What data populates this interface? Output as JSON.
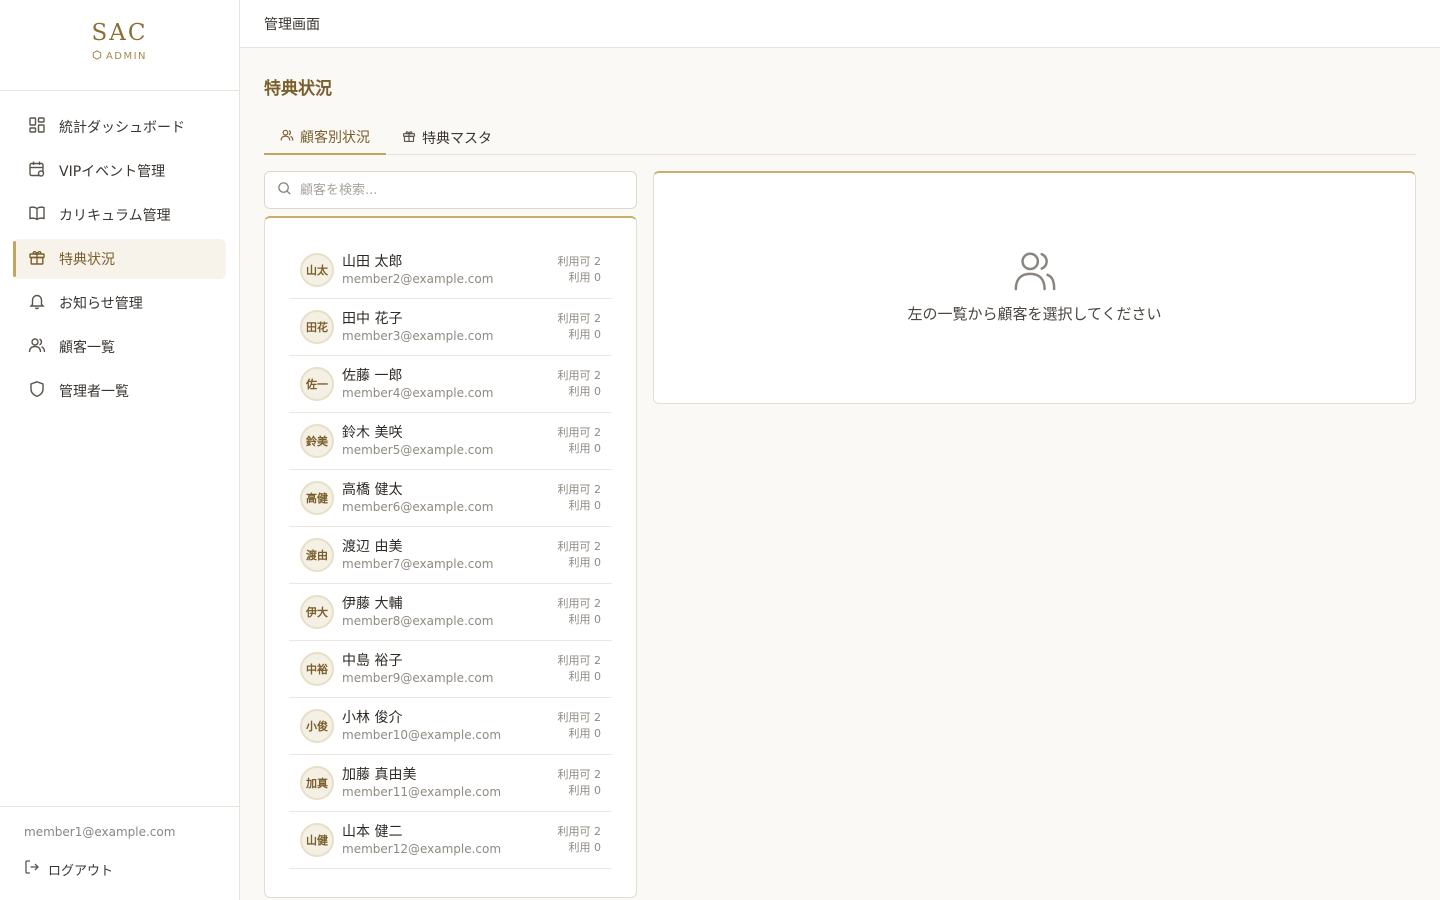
{
  "brand": {
    "name": "SAC",
    "sub": "ADMIN"
  },
  "nav": {
    "items": [
      {
        "label": "統計ダッシュボード",
        "icon": "dashboard-icon"
      },
      {
        "label": "VIPイベント管理",
        "icon": "calendar-icon"
      },
      {
        "label": "カリキュラム管理",
        "icon": "book-icon"
      },
      {
        "label": "特典状況",
        "icon": "gift-icon",
        "active": true
      },
      {
        "label": "お知らせ管理",
        "icon": "bell-icon"
      },
      {
        "label": "顧客一覧",
        "icon": "users-icon"
      },
      {
        "label": "管理者一覧",
        "icon": "shield-icon"
      }
    ]
  },
  "footer": {
    "email": "member1@example.com",
    "logout_label": "ログアウト"
  },
  "header": {
    "title": "管理画面"
  },
  "page": {
    "title": "特典状況"
  },
  "tabs": [
    {
      "label": "顧客別状況",
      "icon": "users-icon",
      "active": true
    },
    {
      "label": "特典マスタ",
      "icon": "gift-icon"
    }
  ],
  "search": {
    "placeholder": "顧客を検索...",
    "value": ""
  },
  "customers": [
    {
      "initials": "山太",
      "name": "山田 太郎",
      "email": "member2@example.com",
      "available": "利用可 2",
      "used": "利用 0"
    },
    {
      "initials": "田花",
      "name": "田中 花子",
      "email": "member3@example.com",
      "available": "利用可 2",
      "used": "利用 0"
    },
    {
      "initials": "佐一",
      "name": "佐藤 一郎",
      "email": "member4@example.com",
      "available": "利用可 2",
      "used": "利用 0"
    },
    {
      "initials": "鈴美",
      "name": "鈴木 美咲",
      "email": "member5@example.com",
      "available": "利用可 2",
      "used": "利用 0"
    },
    {
      "initials": "高健",
      "name": "高橋 健太",
      "email": "member6@example.com",
      "available": "利用可 2",
      "used": "利用 0"
    },
    {
      "initials": "渡由",
      "name": "渡辺 由美",
      "email": "member7@example.com",
      "available": "利用可 2",
      "used": "利用 0"
    },
    {
      "initials": "伊大",
      "name": "伊藤 大輔",
      "email": "member8@example.com",
      "available": "利用可 2",
      "used": "利用 0"
    },
    {
      "initials": "中裕",
      "name": "中島 裕子",
      "email": "member9@example.com",
      "available": "利用可 2",
      "used": "利用 0"
    },
    {
      "initials": "小俊",
      "name": "小林 俊介",
      "email": "member10@example.com",
      "available": "利用可 2",
      "used": "利用 0"
    },
    {
      "initials": "加真",
      "name": "加藤 真由美",
      "email": "member11@example.com",
      "available": "利用可 2",
      "used": "利用 0"
    },
    {
      "initials": "山健",
      "name": "山本 健二",
      "email": "member12@example.com",
      "available": "利用可 2",
      "used": "利用 0"
    }
  ],
  "detail": {
    "empty_message": "左の一覧から顧客を選択してください",
    "icon": "users-icon"
  },
  "colors": {
    "accent": "#c2a560",
    "brand": "#8a7035",
    "background": "#faf9f6"
  }
}
